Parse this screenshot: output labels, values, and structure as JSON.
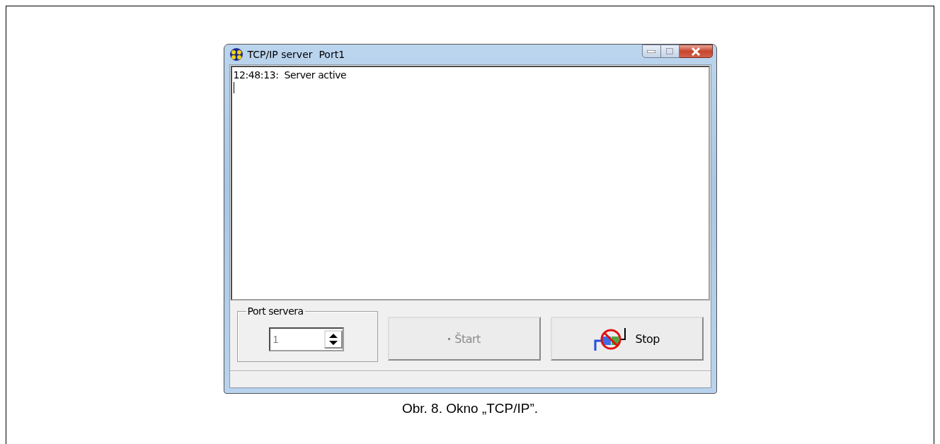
{
  "window": {
    "title": "TCP/IP server  Port1"
  },
  "log": {
    "lines": [
      "12:48:13:  Server active"
    ]
  },
  "port_group": {
    "label": "Port servera",
    "value": "1"
  },
  "buttons": [
    {
      "label": "Štart",
      "disabled": true,
      "kind": "start"
    },
    {
      "label": "Stop",
      "disabled": false,
      "kind": "stop"
    }
  ],
  "caption": "Obr. 8. Okno „TCP/IP”."
}
